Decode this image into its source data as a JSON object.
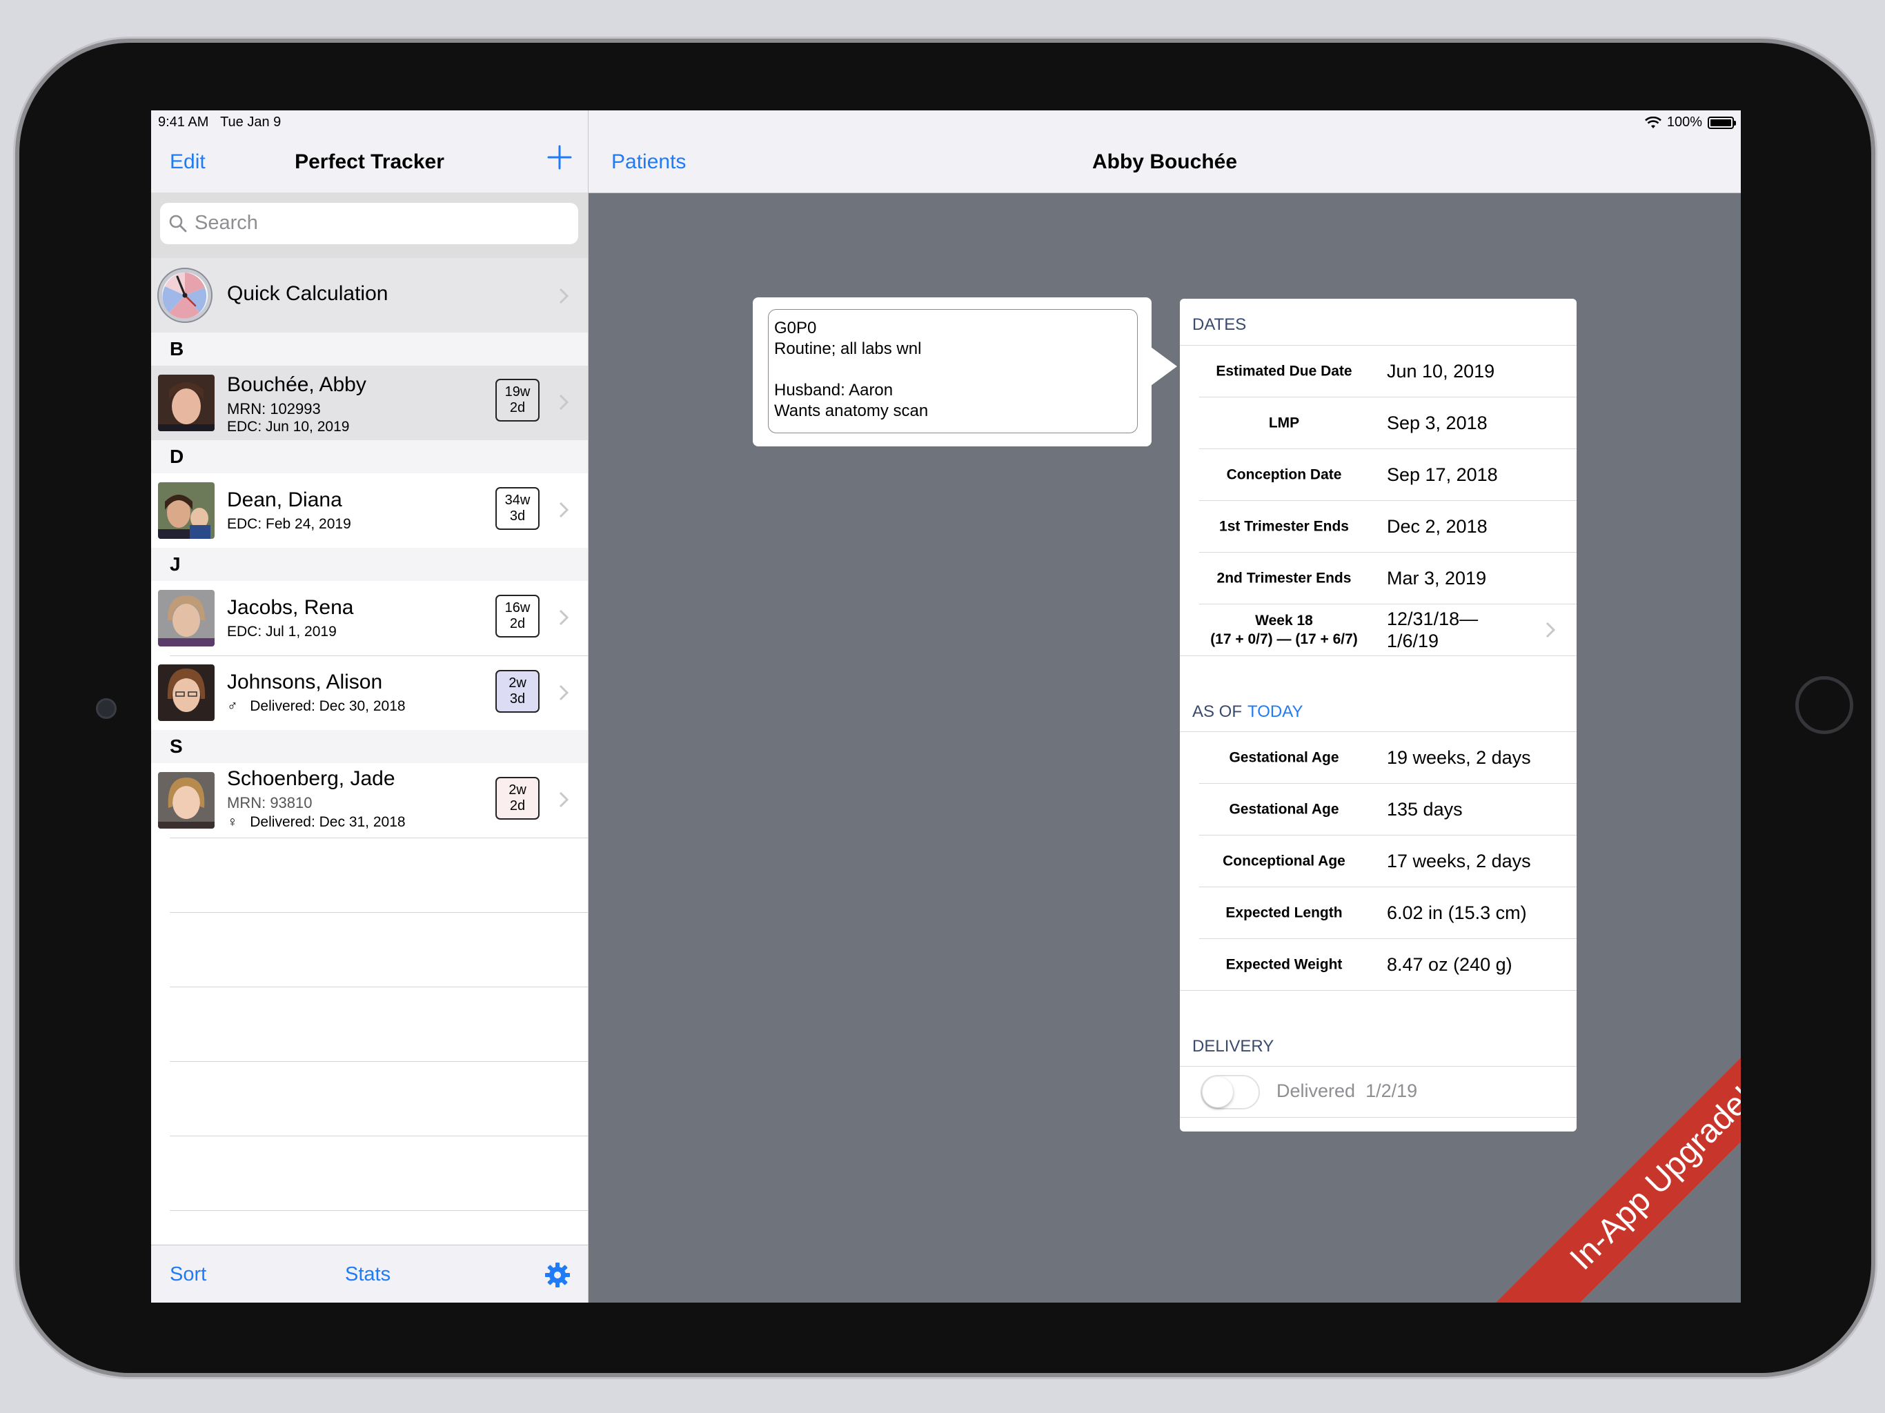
{
  "status_bar": {
    "time": "9:41 AM",
    "date": "Tue Jan 9",
    "battery": "100%"
  },
  "master": {
    "nav": {
      "edit": "Edit",
      "title": "Perfect Tracker",
      "add_icon": "plus-icon"
    },
    "search": {
      "placeholder": "Search"
    },
    "quick": {
      "label": "Quick Calculation"
    },
    "sections": [
      {
        "letter": "B"
      },
      {
        "letter": "D"
      },
      {
        "letter": "J"
      },
      {
        "letter": "S"
      }
    ],
    "patients": [
      {
        "name": "Bouchée, Abby",
        "line1": "MRN: 102993",
        "line2": "EDC: Jun 10, 2019",
        "badge_w": "19w",
        "badge_d": "2d"
      },
      {
        "name": "Dean, Diana",
        "line1": "EDC: Feb 24, 2019",
        "badge_w": "34w",
        "badge_d": "3d"
      },
      {
        "name": "Jacobs, Rena",
        "line1": "EDC: Jul 1, 2019",
        "badge_w": "16w",
        "badge_d": "2d"
      },
      {
        "name": "Johnsons, Alison",
        "line1_symbol": "♂",
        "line1": "Delivered: Dec 30, 2018",
        "badge_w": "2w",
        "badge_d": "3d"
      },
      {
        "name": "Schoenberg, Jade",
        "line1": "MRN: 93810",
        "line2_symbol": "♀",
        "line2": "Delivered: Dec 31, 2018",
        "badge_w": "2w",
        "badge_d": "2d"
      }
    ],
    "toolbar": {
      "sort": "Sort",
      "stats": "Stats",
      "settings_icon": "gear-icon"
    }
  },
  "detail": {
    "nav": {
      "back": "Patients",
      "title": "Abby Bouchée"
    },
    "note": {
      "line1": "G0P0",
      "line2": "Routine; all labs wnl",
      "line3": "Husband: Aaron",
      "line4": "Wants anatomy scan"
    },
    "dates": {
      "header": "DATES",
      "rows": [
        {
          "k": "Estimated Due Date",
          "v": "Jun 10, 2019"
        },
        {
          "k": "LMP",
          "v": "Sep 3, 2018"
        },
        {
          "k": "Conception Date",
          "v": "Sep 17, 2018"
        },
        {
          "k": "1st Trimester Ends",
          "v": "Dec 2, 2018"
        },
        {
          "k": "2nd Trimester Ends",
          "v": "Mar 3, 2019"
        },
        {
          "k1": "Week 18",
          "k2": "(17 + 0/7) — (17 + 6/7)",
          "v1": "12/31/18—",
          "v2": "1/6/19"
        }
      ]
    },
    "as_of": {
      "header": "AS OF",
      "today": "TODAY",
      "rows": [
        {
          "k": "Gestational Age",
          "v": "19 weeks, 2 days"
        },
        {
          "k": "Gestational Age",
          "v": "135 days"
        },
        {
          "k": "Conceptional Age",
          "v": "17 weeks, 2 days"
        },
        {
          "k": "Expected Length",
          "v": "6.02 in (15.3 cm)"
        },
        {
          "k": "Expected Weight",
          "v": "8.47 oz (240 g)"
        }
      ]
    },
    "delivery": {
      "header": "DELIVERY",
      "label": "Delivered",
      "date": "1/2/19",
      "toggle_on": false
    }
  },
  "ribbon": {
    "text": "In-App Upgrade!"
  },
  "colors": {
    "accent": "#1f7bf6",
    "ribbon": "#c8352b",
    "detail_bg": "#6f737c"
  }
}
